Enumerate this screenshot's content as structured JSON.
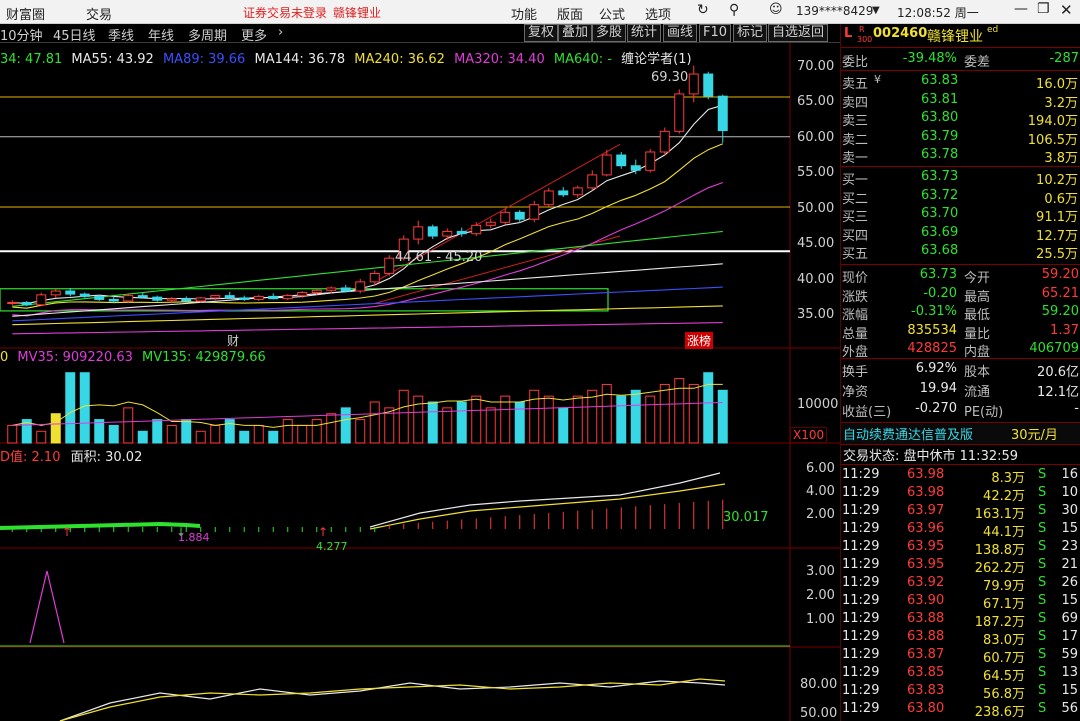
{
  "menubar": {
    "left_items": [
      "财富圈",
      "交易"
    ],
    "notice": "证券交易未登录",
    "stock_name": "赣锋锂业",
    "right_items": [
      "功能",
      "版面",
      "公式",
      "选项"
    ],
    "user": "139****8429",
    "clock": "12:08:52 周一"
  },
  "toolbar": {
    "periods": [
      "10分钟",
      "45日线",
      "季线",
      "年线",
      "多周期",
      "更多"
    ],
    "buttons": [
      "复权",
      "叠加",
      "多股",
      "统计",
      "画线",
      "F10",
      "标记",
      "自选返回"
    ]
  },
  "ma_legend": {
    "ma_a": "34: 47.81",
    "ma55": "MA55: 43.92",
    "ma89": "MA89: 39.66",
    "ma144": "MA144: 36.78",
    "ma240": "MA240: 36.62",
    "ma320": "MA320: 34.40",
    "ma640": "MA640: -",
    "indicator": "缠论学者(1)"
  },
  "price_axis": [
    "70.00",
    "65.00",
    "60.00",
    "55.00",
    "50.00",
    "45.00",
    "40.00",
    "35.00"
  ],
  "annotations": {
    "high": "69.30",
    "range": "44.61 - 45.20",
    "tag_cai": "财",
    "tag_zb": "涨榜"
  },
  "colors": {
    "up": "#ff3a3a",
    "down": "#37d7e6",
    "ma_white": "#e8e8e8",
    "ma_yellow": "#f0e030",
    "ma_magenta": "#e03cd9",
    "ma_green": "#2fe12f",
    "ma_blue": "#3a50ff",
    "bg": "#000000"
  },
  "volume": {
    "legend_prefix": "0",
    "mv35": "MV35: 909220.63",
    "mv135": "MV135: 429879.66",
    "axis_label": "10000",
    "unit": "X100"
  },
  "indicator2": {
    "title_prefix": "D值:",
    "title_value": "2.10",
    "title_area": "面积: 30.02",
    "axis": [
      "6.00",
      "4.00",
      "2.00"
    ],
    "last_value": "30.017",
    "markers": [
      "1.884",
      "4.277"
    ]
  },
  "indicator3": {
    "axis": [
      "3.00",
      "2.00",
      "1.00"
    ]
  },
  "indicator4": {
    "axis": [
      "80.00",
      "50.00"
    ]
  },
  "quote": {
    "prefix": "L",
    "sup": "R",
    "sub": "300",
    "code": "002460",
    "name": "赣锋锂业",
    "tag": "ed",
    "weibi_label": "委比",
    "weibi_value": "-39.48%",
    "weicha_label": "委差",
    "weicha_value": "-287",
    "sells": [
      {
        "label": "卖五",
        "price": "63.83",
        "vol": "16.0万"
      },
      {
        "label": "卖四",
        "price": "63.81",
        "vol": "3.2万"
      },
      {
        "label": "卖三",
        "price": "63.80",
        "vol": "194.0万"
      },
      {
        "label": "卖二",
        "price": "63.79",
        "vol": "106.5万"
      },
      {
        "label": "卖一",
        "price": "63.78",
        "vol": "3.8万"
      }
    ],
    "sell5_mark": "¥",
    "buys": [
      {
        "label": "买一",
        "price": "63.73",
        "vol": "10.2万"
      },
      {
        "label": "买二",
        "price": "63.72",
        "vol": "0.6万"
      },
      {
        "label": "买三",
        "price": "63.70",
        "vol": "91.1万"
      },
      {
        "label": "买四",
        "price": "63.69",
        "vol": "12.7万"
      },
      {
        "label": "买五",
        "price": "63.68",
        "vol": "25.5万"
      }
    ],
    "stats": [
      {
        "l1": "现价",
        "v1": "63.73",
        "l2": "今开",
        "v2": "59.20"
      },
      {
        "l1": "涨跌",
        "v1": "-0.20",
        "l2": "最高",
        "v2": "65.21"
      },
      {
        "l1": "涨幅",
        "v1": "-0.31%",
        "l2": "最低",
        "v2": "59.20"
      },
      {
        "l1": "总量",
        "v1": "835534",
        "l2": "量比",
        "v2": "1.37"
      },
      {
        "l1": "外盘",
        "v1": "428825",
        "l2": "内盘",
        "v2": "406709"
      }
    ],
    "finance": [
      {
        "l1": "换手",
        "v1": "6.92%",
        "l2": "股本",
        "v2": "20.6亿"
      },
      {
        "l1": "净资",
        "v1": "19.94",
        "l2": "流通",
        "v2": "12.1亿"
      },
      {
        "l1": "收益(三)",
        "v1": "-0.270",
        "l2": "PE(动)",
        "v2": "-"
      }
    ],
    "promo": "自动续费通达信普及版",
    "promo_price": "30元/月",
    "status": "交易状态: 盘中休市 11:32:59"
  },
  "ticks": [
    {
      "t": "11:29",
      "p": "63.98",
      "v": "8.3万",
      "s": "S",
      "n": "16"
    },
    {
      "t": "11:29",
      "p": "63.98",
      "v": "42.2万",
      "s": "S",
      "n": "10"
    },
    {
      "t": "11:29",
      "p": "63.97",
      "v": "163.1万",
      "s": "S",
      "n": "30"
    },
    {
      "t": "11:29",
      "p": "63.96",
      "v": "44.1万",
      "s": "S",
      "n": "15"
    },
    {
      "t": "11:29",
      "p": "63.95",
      "v": "138.8万",
      "s": "S",
      "n": "23"
    },
    {
      "t": "11:29",
      "p": "63.95",
      "v": "262.2万",
      "s": "S",
      "n": "21"
    },
    {
      "t": "11:29",
      "p": "63.92",
      "v": "79.9万",
      "s": "S",
      "n": "26"
    },
    {
      "t": "11:29",
      "p": "63.90",
      "v": "67.1万",
      "s": "S",
      "n": "15"
    },
    {
      "t": "11:29",
      "p": "63.88",
      "v": "187.2万",
      "s": "S",
      "n": "69"
    },
    {
      "t": "11:29",
      "p": "63.88",
      "v": "83.0万",
      "s": "S",
      "n": "17"
    },
    {
      "t": "11:29",
      "p": "63.87",
      "v": "60.7万",
      "s": "S",
      "n": "59"
    },
    {
      "t": "11:29",
      "p": "63.85",
      "v": "64.5万",
      "s": "S",
      "n": "13"
    },
    {
      "t": "11:29",
      "p": "63.83",
      "v": "56.8万",
      "s": "S",
      "n": "15"
    },
    {
      "t": "11:29",
      "p": "63.80",
      "v": "238.6万",
      "s": "S",
      "n": "56"
    }
  ],
  "chart_data": [
    {
      "type": "candlestick",
      "title": "",
      "ylim": [
        33,
        72
      ],
      "candles": [
        [
          38.2,
          38.6,
          37.9,
          38.3
        ],
        [
          38.3,
          38.5,
          37.8,
          38.0
        ],
        [
          38.0,
          39.6,
          37.8,
          39.3
        ],
        [
          39.3,
          40.1,
          38.9,
          39.8
        ],
        [
          39.8,
          40.2,
          39.1,
          39.4
        ],
        [
          39.4,
          39.6,
          38.9,
          39.1
        ],
        [
          39.1,
          39.3,
          38.5,
          38.7
        ],
        [
          38.7,
          39.1,
          38.2,
          38.5
        ],
        [
          38.5,
          39.4,
          38.3,
          39.2
        ],
        [
          39.2,
          39.6,
          38.8,
          39.0
        ],
        [
          39.0,
          39.2,
          38.4,
          38.6
        ],
        [
          38.6,
          39.0,
          38.2,
          38.8
        ],
        [
          38.8,
          39.1,
          38.4,
          38.5
        ],
        [
          38.5,
          39.0,
          38.3,
          38.9
        ],
        [
          38.9,
          39.3,
          38.6,
          39.2
        ],
        [
          39.2,
          39.7,
          38.8,
          38.9
        ],
        [
          38.9,
          39.2,
          38.5,
          38.7
        ],
        [
          38.7,
          39.3,
          38.5,
          39.1
        ],
        [
          39.1,
          39.5,
          38.7,
          38.8
        ],
        [
          38.8,
          39.4,
          38.6,
          39.2
        ],
        [
          39.2,
          39.8,
          38.9,
          39.6
        ],
        [
          39.6,
          40.1,
          39.3,
          39.9
        ],
        [
          39.9,
          40.4,
          39.5,
          40.2
        ],
        [
          40.2,
          40.6,
          39.6,
          39.8
        ],
        [
          39.8,
          41.4,
          39.5,
          41.0
        ],
        [
          41.0,
          42.5,
          40.6,
          42.1
        ],
        [
          42.1,
          44.5,
          41.8,
          44.1
        ],
        [
          44.1,
          47.1,
          43.8,
          46.6
        ],
        [
          46.6,
          49.0,
          45.9,
          48.2
        ],
        [
          48.2,
          48.5,
          46.6,
          47.0
        ],
        [
          47.0,
          48.0,
          46.5,
          47.6
        ],
        [
          47.6,
          48.1,
          46.9,
          47.3
        ],
        [
          47.3,
          48.8,
          47.0,
          48.4
        ],
        [
          48.4,
          49.3,
          48.0,
          48.8
        ],
        [
          48.8,
          50.6,
          48.5,
          50.1
        ],
        [
          50.1,
          50.4,
          48.7,
          49.2
        ],
        [
          49.2,
          51.6,
          48.8,
          51.1
        ],
        [
          51.1,
          53.3,
          50.9,
          52.9
        ],
        [
          52.9,
          53.4,
          52.1,
          52.4
        ],
        [
          52.4,
          53.6,
          52.0,
          53.3
        ],
        [
          53.3,
          55.6,
          53.0,
          55.0
        ],
        [
          55.0,
          58.3,
          54.8,
          57.6
        ],
        [
          57.6,
          58.0,
          55.8,
          56.2
        ],
        [
          56.2,
          57.0,
          55.1,
          55.6
        ],
        [
          55.6,
          58.4,
          55.3,
          58.0
        ],
        [
          58.0,
          61.2,
          57.6,
          60.7
        ],
        [
          60.7,
          66.2,
          60.4,
          65.6
        ],
        [
          65.6,
          69.3,
          64.5,
          68.2
        ],
        [
          68.2,
          68.5,
          64.9,
          65.3
        ],
        [
          65.3,
          65.5,
          59.2,
          60.8
        ]
      ]
    },
    {
      "type": "bar",
      "title": "",
      "volumes": [
        3,
        4,
        2,
        5,
        12,
        12,
        4,
        3,
        6,
        2,
        4,
        3,
        4,
        2,
        3,
        4,
        2,
        3,
        2,
        4,
        3,
        4,
        5,
        6,
        4,
        7,
        6,
        9,
        8,
        7,
        6,
        7,
        8,
        6,
        8,
        7,
        9,
        8,
        6,
        8,
        9,
        10,
        8,
        9,
        8,
        10,
        11,
        10,
        12,
        9
      ],
      "vol_max": 14
    }
  ]
}
